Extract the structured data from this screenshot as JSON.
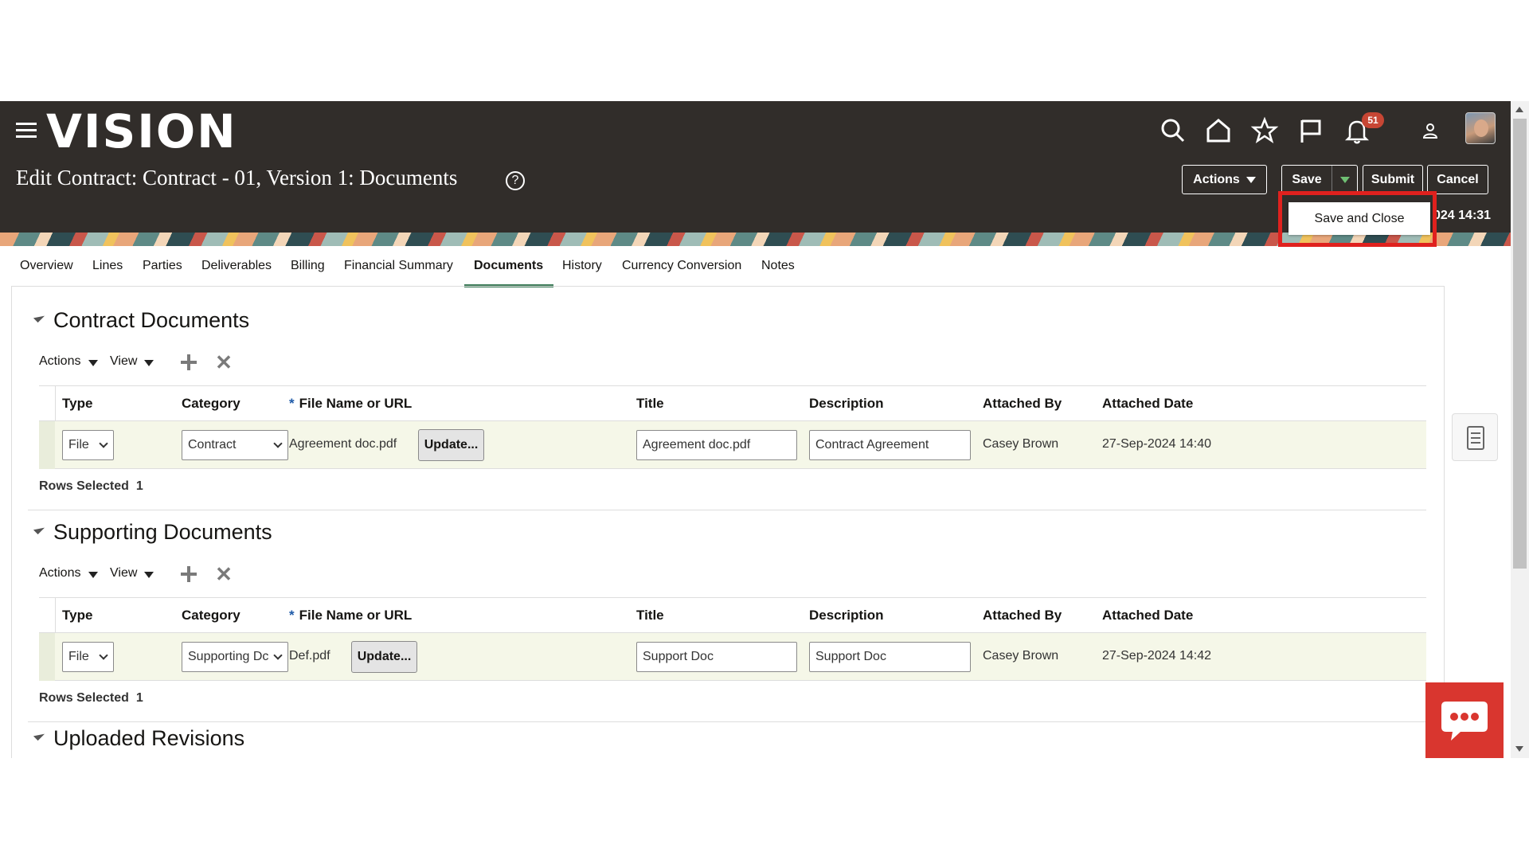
{
  "header": {
    "logo": "VISION",
    "page_title": "Edit Contract: Contract - 01, Version 1: Documents",
    "help": "?",
    "notification_count": "51",
    "icons": [
      "menu-icon",
      "search-icon",
      "home-icon",
      "star-icon",
      "flag-icon",
      "bell-icon",
      "user-icon"
    ],
    "actions_label": "Actions",
    "save_label": "Save",
    "submit_label": "Submit",
    "cancel_label": "Cancel",
    "timestamp_partial": "024 14:31"
  },
  "dropdown": {
    "save_and_close": "Save and Close",
    "highlight_color": "#e0211e"
  },
  "tabs": [
    {
      "label": "Overview"
    },
    {
      "label": "Lines"
    },
    {
      "label": "Parties"
    },
    {
      "label": "Deliverables"
    },
    {
      "label": "Billing"
    },
    {
      "label": "Financial Summary"
    },
    {
      "label": "Documents",
      "active": true
    },
    {
      "label": "History"
    },
    {
      "label": "Currency Conversion"
    },
    {
      "label": "Notes"
    }
  ],
  "toolbar": {
    "actions": "Actions",
    "view": "View"
  },
  "columns": {
    "type": "Type",
    "category": "Category",
    "required_mark": "*",
    "file": "File Name or URL",
    "title": "Title",
    "description": "Description",
    "attached_by": "Attached By",
    "attached_date": "Attached Date"
  },
  "contract_documents": {
    "title": "Contract Documents",
    "row": {
      "type": "File",
      "category": "Contract",
      "file_name": "Agreement doc.pdf",
      "update": "Update...",
      "title": "Agreement doc.pdf",
      "description": "Contract Agreement",
      "attached_by": "Casey Brown",
      "attached_date": "27-Sep-2024 14:40"
    },
    "rows_selected_label": "Rows Selected",
    "rows_selected_count": "1"
  },
  "supporting_documents": {
    "title": "Supporting Documents",
    "row": {
      "type": "File",
      "category": "Supporting Dc",
      "file_name": "Def.pdf",
      "update": "Update...",
      "title": "Support Doc",
      "description": "Support Doc",
      "attached_by": "Casey Brown",
      "attached_date": "27-Sep-2024 14:42"
    },
    "rows_selected_label": "Rows Selected",
    "rows_selected_count": "1"
  },
  "uploaded_revisions": {
    "title": "Uploaded Revisions"
  },
  "colors": {
    "header_bg": "#312d2a",
    "accent_tab": "#3b7a57",
    "chat": "#d9362f",
    "row_bg": "#f5f7e8"
  }
}
